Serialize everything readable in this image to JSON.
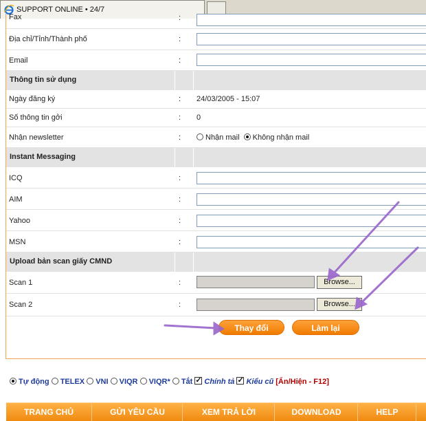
{
  "tab": {
    "title": "SUPPORT ONLINE • 24/7"
  },
  "form": {
    "fax_label": "Fax",
    "address_label": "Địa chỉ/Tỉnh/Thành phố",
    "email_label": "Email",
    "colon": ":",
    "section_usage": "Thông tin sử dụng",
    "reg_date_label": "Ngày đăng ký",
    "reg_date_value": "24/03/2005 - 15:07",
    "msg_count_label": "Số thông tin gởi",
    "msg_count_value": "0",
    "newsletter_label": "Nhận newsletter",
    "newsletter_opt_yes": "Nhận mail",
    "newsletter_opt_no": "Không nhận mail",
    "section_im": "Instant Messaging",
    "icq_label": "ICQ",
    "aim_label": "AIM",
    "yahoo_label": "Yahoo",
    "msn_label": "MSN",
    "section_upload": "Upload bản scan giấy CMND",
    "scan1_label": "Scan 1",
    "scan2_label": "Scan 2",
    "browse_label": "Browse...",
    "submit_label": "Thay đổi",
    "reset_label": "Làm lại"
  },
  "ime": {
    "auto": "Tự động",
    "telex": "TELEX",
    "vni": "VNI",
    "viqr": "VIQR",
    "viqr_star": "VIQR*",
    "off": "Tắt",
    "spell": "Chính tả",
    "old_style": "Kiểu cũ",
    "toggle": "[Ẩn/Hiện - F12]"
  },
  "nav": {
    "home": "TRANG CHỦ",
    "send": "GỬI YÊU CẦU",
    "view": "XEM TRẢ LỜI",
    "download": "DOWNLOAD",
    "help": "HELP"
  },
  "colors": {
    "accent": "#f08a10",
    "section": "#e3e3e3",
    "arrow": "#9966cc",
    "ime_text": "#1f3c9c"
  }
}
